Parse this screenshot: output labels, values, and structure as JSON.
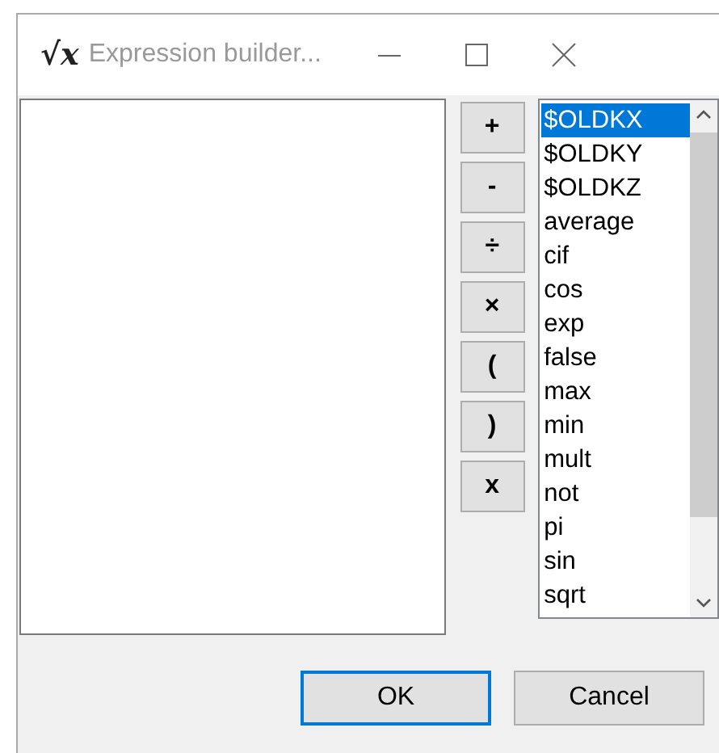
{
  "window": {
    "title": "Expression builder...",
    "icon": "√x"
  },
  "operators": [
    "+",
    "-",
    "÷",
    "×",
    "(",
    ")",
    "x"
  ],
  "functions": [
    {
      "label": "$OLDKX",
      "selected": true
    },
    {
      "label": "$OLDKY",
      "selected": false
    },
    {
      "label": "$OLDKZ",
      "selected": false
    },
    {
      "label": "average",
      "selected": false
    },
    {
      "label": "cif",
      "selected": false
    },
    {
      "label": "cos",
      "selected": false
    },
    {
      "label": "exp",
      "selected": false
    },
    {
      "label": "false",
      "selected": false
    },
    {
      "label": "max",
      "selected": false
    },
    {
      "label": "min",
      "selected": false
    },
    {
      "label": "mult",
      "selected": false
    },
    {
      "label": "not",
      "selected": false
    },
    {
      "label": "pi",
      "selected": false
    },
    {
      "label": "sin",
      "selected": false
    },
    {
      "label": "sqrt",
      "selected": false
    }
  ],
  "buttons": [
    {
      "label": "OK",
      "default": true
    },
    {
      "label": "Cancel",
      "default": false
    }
  ]
}
